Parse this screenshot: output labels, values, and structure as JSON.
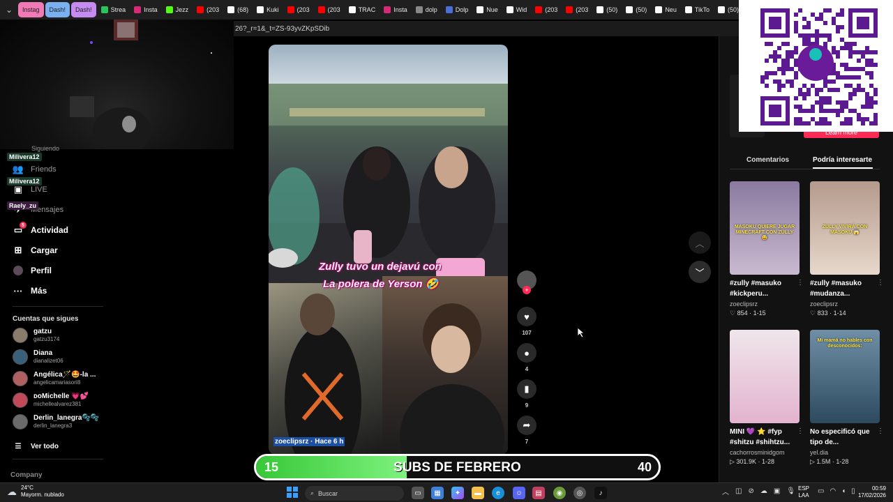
{
  "browser": {
    "tab_groups": [
      "Instag",
      "Dash!",
      "Dash!"
    ],
    "tabs": [
      {
        "label": "Strea",
        "color": "#29c45a"
      },
      {
        "label": "Insta",
        "color": "#d62976"
      },
      {
        "label": "Jezz",
        "color": "#53fc18"
      },
      {
        "label": "(203",
        "color": "#ff0000"
      },
      {
        "label": "(68)",
        "color": "#ffffff"
      },
      {
        "label": "Kuki",
        "color": "#ffffff"
      },
      {
        "label": "(203",
        "color": "#ff0000"
      },
      {
        "label": "(203",
        "color": "#ff0000"
      },
      {
        "label": "TRAC",
        "color": "#ffffff"
      },
      {
        "label": "Insta",
        "color": "#d62976"
      },
      {
        "label": "dolp",
        "color": "#888888"
      },
      {
        "label": "Dolp",
        "color": "#4a6fd8"
      },
      {
        "label": "Nue",
        "color": "#ffffff"
      },
      {
        "label": "Wid",
        "color": "#ffffff"
      },
      {
        "label": "(203",
        "color": "#ff0000"
      },
      {
        "label": "(203",
        "color": "#ff0000"
      },
      {
        "label": "(50)",
        "color": "#ffffff"
      },
      {
        "label": "(50)",
        "color": "#ffffff"
      },
      {
        "label": "Neu",
        "color": "#ffffff"
      },
      {
        "label": "TikTo",
        "color": "#ffffff"
      },
      {
        "label": "(50)",
        "color": "#ffffff"
      },
      {
        "label": "(50)",
        "color": "#ffffff"
      }
    ],
    "url_fragment": "26?_r=1&_t=ZS-93yvZKpSDib"
  },
  "chat": {
    "users": [
      "Milivera12",
      "Milivera12",
      "Raely_zu"
    ]
  },
  "sidebar": {
    "partial_top": "Siguiendo",
    "friends": "Friends",
    "live": "LIVE",
    "messages": "Mensajes",
    "activity": "Actividad",
    "activity_badge": "5",
    "upload": "Cargar",
    "profile": "Perfil",
    "more": "Más",
    "following_title": "Cuentas que sigues",
    "accounts": [
      {
        "name": "gatzu",
        "handle": "gatzu3174"
      },
      {
        "name": "Diana",
        "handle": "dianalizet06"
      },
      {
        "name": "Angélica🪄🤩-la ...",
        "handle": "angelicamariasori8"
      },
      {
        "name": "ᴅᴏMichelle 💗💕",
        "handle": "michellealvarez381"
      },
      {
        "name": "Derlin_lanegra🫧🫧",
        "handle": "derlin_lanegra3"
      }
    ],
    "see_all": "Ver todo",
    "company": "Company"
  },
  "video": {
    "caption_line1": "Zully tuvo un dejavú con",
    "caption_line2": "La polera de Yerson 🤣",
    "author_meta": "zoeclipsrz · Hace 6 h",
    "likes": "107",
    "comments": "4",
    "saves": "9",
    "shares": "7"
  },
  "right_panel": {
    "learn_more": "Learn more",
    "tab_comments": "Comentarios",
    "tab_suggested": "Podría interesarte",
    "cards": [
      {
        "title": "#zully #masuko #kickperu...",
        "author": "zoeclipsrz",
        "stats": "♡ 854 · 1-15",
        "caption": "MASOKU QUIERE JUGAR MINECRAFT CON ZULLY 😅",
        "c1": "#8a7aa0",
        "c2": "#c9b9cf"
      },
      {
        "title": "#zully #masuko #mudanza...",
        "author": "zoeclipsrz",
        "stats": "♡ 833 · 1-14",
        "caption": "ZULLY VIVIRÁ CON MASOKU 😱",
        "c1": "#b49a8c",
        "c2": "#e7d8cc"
      },
      {
        "title": "MINI 💜 ⭐ #fyp #shitzu #shihtzu...",
        "author": "cachorrosminidgom",
        "stats": "▷ 301.9K · 1-28",
        "caption": "",
        "c1": "#efe6ea",
        "c2": "#e3b3cf"
      },
      {
        "title": "No especificó que tipo de...",
        "author": "yel.dia",
        "stats": "▷ 1.5M · 1-28",
        "caption": "Mi mamá no hables con desconocidos:",
        "c1": "#6f8fa6",
        "c2": "#2d4a5f"
      }
    ]
  },
  "subs_bar": {
    "current": "15",
    "goal": "40",
    "title": "SUBS DE FEBRERO",
    "progress": 0.375
  },
  "taskbar": {
    "temp": "24°C",
    "weather": "Mayorm. nublado",
    "search": "Buscar",
    "lang1": "ESP",
    "lang2": "LAA",
    "time": "00:59",
    "date": "17/02/2026"
  }
}
